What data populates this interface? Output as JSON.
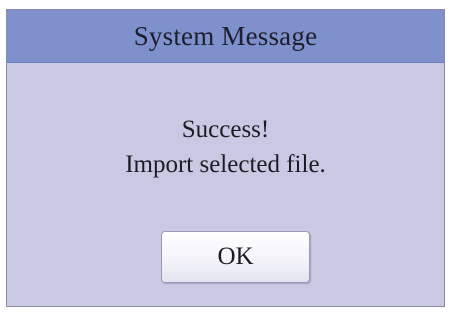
{
  "dialog": {
    "title": "System Message",
    "message_line1": "Success!",
    "message_line2": "Import selected file.",
    "ok_label": "OK"
  },
  "colors": {
    "title_bar": "#7f91cc",
    "dialog_background": "#cac9e3",
    "button_background": "#f4f4fa",
    "text": "#1c1c24"
  }
}
